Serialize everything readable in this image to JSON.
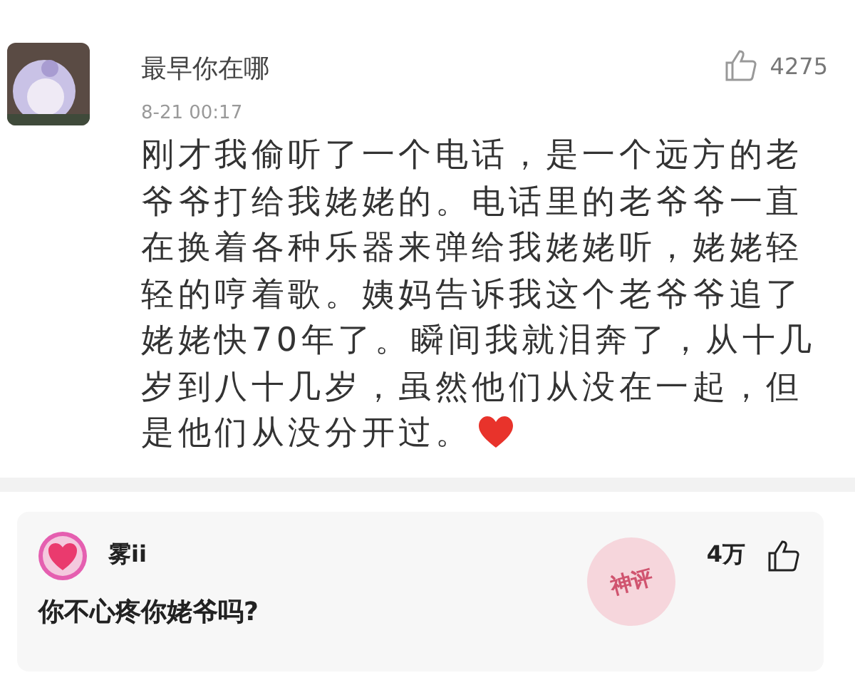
{
  "comment": {
    "author": "最早你在哪",
    "time": "8-21 00:17",
    "likes": "4275",
    "text": "刚才我偷听了一个电话，是一个远方的老爷爷打给我姥姥的。电话里的老爷爷一直在换着各种乐器来弹给我姥姥听，姥姥轻轻的哼着歌。姨妈告诉我这个老爷爷追了姥姥快70年了。瞬间我就泪奔了，从十几岁到八十几岁，虽然他们从没在一起，但是他们从没分开过。"
  },
  "reply": {
    "author": "雾ii",
    "likes": "4万",
    "text": "你不心疼你姥爷吗?",
    "badge": "神评"
  }
}
